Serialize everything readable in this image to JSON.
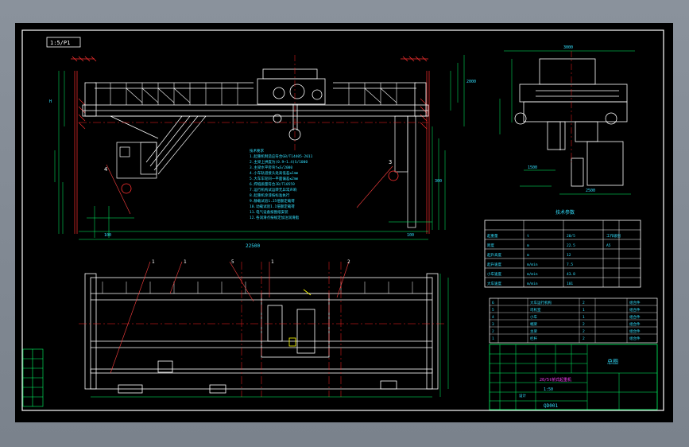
{
  "drawing": {
    "colors": {
      "background": "#000000",
      "frame": "#ffffff",
      "structure": "#ffffff",
      "dimension": "#00ff66",
      "annotation": "#33e0ff",
      "centerline": "#ff2020",
      "leader": "#ff4040",
      "title_box": "#00ff66",
      "highlight": "#ffff00",
      "magenta": "#ff40ff"
    },
    "front_view": {
      "span_dim": "22500",
      "corner_tag": "1:5/P1"
    },
    "notes": [
      "技术要求",
      "1.起重机制造应符合GB/T14405-2011",
      "2.主梁上拱度为(0.9~1.4)S/1000",
      "3.主梁水平旁弯f≤S/2000",
      "4.小车轨道接头处高低差≤1mm",
      "5.大车车轮同一平面偏差≤2mm",
      "6.焊缝质量符合JB/T10559",
      "7.运行机构试运转无异常声响",
      "8.起重机涂漆按标准执行",
      "9.静载试验1.25倍额定载荷",
      "10.动载试验1.1倍额定载荷",
      "11.电气设备按图纸安装",
      "12.各润滑点按规定加注润滑脂"
    ],
    "param_table": {
      "title": "技术参数",
      "rows": [
        [
          "起重量",
          "t",
          "20/5"
        ],
        [
          "跨度",
          "m",
          "22.5"
        ],
        [
          "起升高度",
          "m",
          "12"
        ],
        [
          "起升速度",
          "m/min",
          "7.5"
        ],
        [
          "小车速度",
          "m/min",
          "43.8"
        ],
        [
          "大车速度",
          "m/min",
          "101"
        ],
        [
          "工作级别",
          "",
          "A5"
        ]
      ]
    },
    "parts_list": [
      [
        "6",
        "大车运行机构",
        "2",
        "组合件"
      ],
      [
        "5",
        "司机室",
        "1",
        "组合件"
      ],
      [
        "4",
        "小车",
        "1",
        "组合件"
      ],
      [
        "3",
        "端梁",
        "2",
        "组合件"
      ],
      [
        "2",
        "主梁",
        "2",
        "组合件"
      ],
      [
        "1",
        "栏杆",
        "2",
        "组合件"
      ]
    ],
    "title_block": {
      "title": "20/5t桥式起重机",
      "scale": "1:50",
      "sheet": "总图",
      "drawing_no": "QD001",
      "designer": "设计"
    }
  }
}
